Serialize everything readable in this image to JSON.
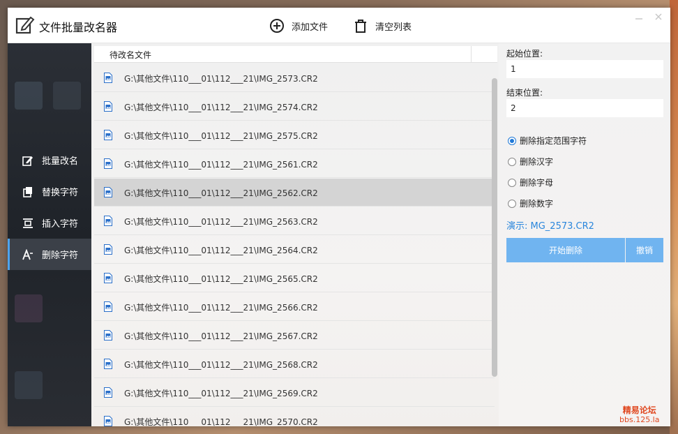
{
  "titlebar": {
    "title": "文件批量改名器",
    "add_file": "添加文件",
    "clear_list": "清空列表"
  },
  "sidebar": {
    "items": [
      {
        "label": "批量改名",
        "icon": "edit-icon"
      },
      {
        "label": "替换字符",
        "icon": "replace-icon"
      },
      {
        "label": "插入字符",
        "icon": "insert-icon"
      },
      {
        "label": "删除字符",
        "icon": "delete-char-icon"
      }
    ],
    "active_index": 3
  },
  "list": {
    "header": "待改名文件",
    "rows": [
      "G:\\其他文件\\110___01\\112___21\\IMG_2573.CR2",
      "G:\\其他文件\\110___01\\112___21\\IMG_2574.CR2",
      "G:\\其他文件\\110___01\\112___21\\IMG_2575.CR2",
      "G:\\其他文件\\110___01\\112___21\\IMG_2561.CR2",
      "G:\\其他文件\\110___01\\112___21\\IMG_2562.CR2",
      "G:\\其他文件\\110___01\\112___21\\IMG_2563.CR2",
      "G:\\其他文件\\110___01\\112___21\\IMG_2564.CR2",
      "G:\\其他文件\\110___01\\112___21\\IMG_2565.CR2",
      "G:\\其他文件\\110___01\\112___21\\IMG_2566.CR2",
      "G:\\其他文件\\110___01\\112___21\\IMG_2567.CR2",
      "G:\\其他文件\\110___01\\112___21\\IMG_2568.CR2",
      "G:\\其他文件\\110___01\\112___21\\IMG_2569.CR2",
      "G:\\其他文件\\110___01\\112___21\\IMG_2570.CR2"
    ],
    "selected_index": 4
  },
  "panel": {
    "start_label": "起始位置:",
    "start_value": "1",
    "end_label": "结束位置:",
    "end_value": "2",
    "options": [
      "删除指定范围字符",
      "删除汉字",
      "删除字母",
      "删除数字"
    ],
    "checked_index": 0,
    "demo": "演示:  MG_2573.CR2",
    "start_button": "开始删除",
    "cancel_button": "撤销"
  },
  "watermark": {
    "line1": "精易论坛",
    "line2": "bbs.125.la"
  },
  "colors": {
    "accent": "#70b4f0",
    "link": "#2a86dc",
    "sidebar_bg": "#23272d"
  }
}
